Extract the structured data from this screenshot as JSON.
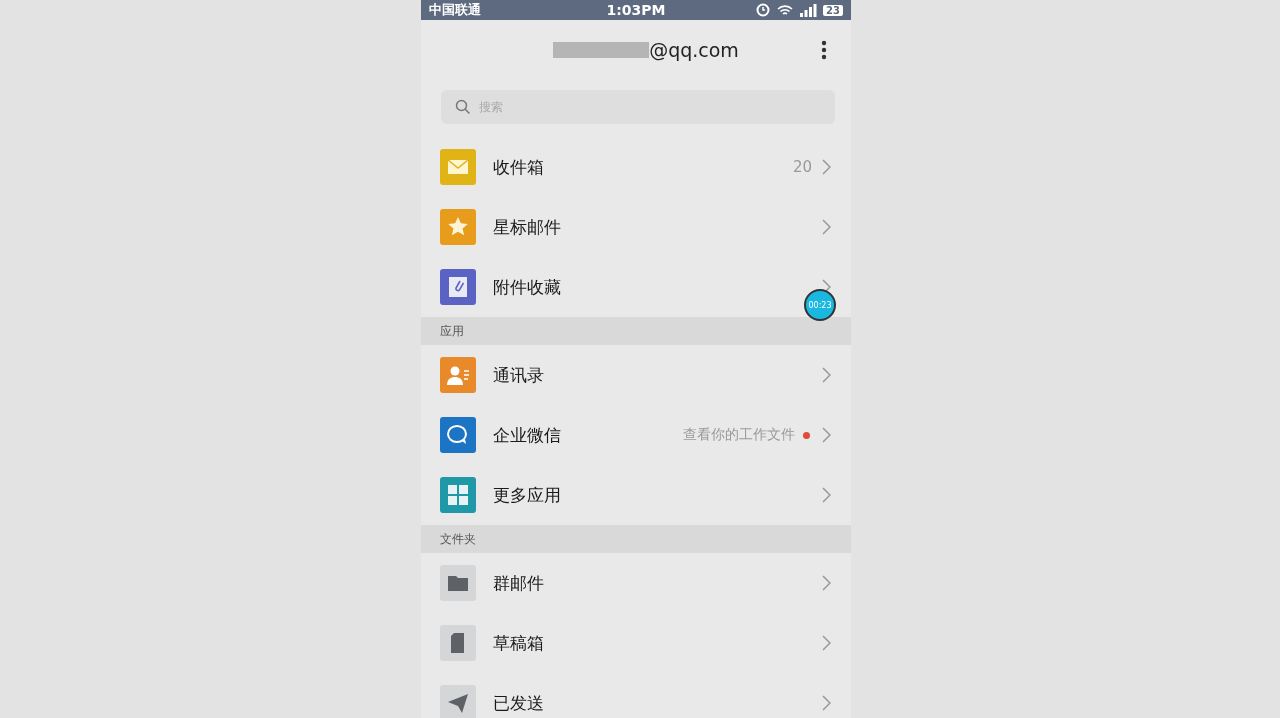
{
  "status_bar": {
    "carrier": "中国联通",
    "time": "1:03PM",
    "battery": "23"
  },
  "header": {
    "account": "@qq.com"
  },
  "search": {
    "placeholder": "搜索"
  },
  "sections": [
    {
      "items": [
        {
          "label": "收件箱",
          "kind": "envelope",
          "color": "#e0b417",
          "count": "20"
        },
        {
          "label": "星标邮件",
          "kind": "star",
          "color": "#e89c1c"
        },
        {
          "label": "附件收藏",
          "kind": "clip",
          "color": "#5a63c4"
        }
      ]
    },
    {
      "title": "应用",
      "items": [
        {
          "label": "通讯录",
          "kind": "contact",
          "color": "#e8892a"
        },
        {
          "label": "企业微信",
          "kind": "chat",
          "color": "#1c74c4",
          "hint": "查看你的工作文件",
          "dot": true
        },
        {
          "label": "更多应用",
          "kind": "grid",
          "color": "#1f98a8"
        }
      ]
    },
    {
      "title": "文件夹",
      "items": [
        {
          "label": "群邮件",
          "kind": "folder",
          "color": "#d4d6d8"
        },
        {
          "label": "草稿箱",
          "kind": "document",
          "color": "#d4d6d8"
        },
        {
          "label": "已发送",
          "kind": "plane",
          "color": "#d4d6d8"
        }
      ]
    }
  ],
  "recorder": {
    "time": "00:23"
  }
}
